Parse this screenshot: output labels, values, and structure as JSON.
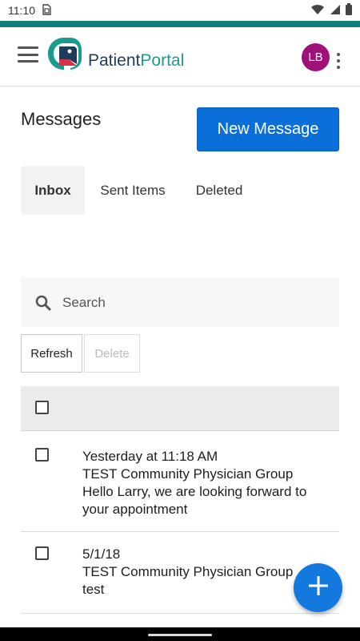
{
  "status_bar": {
    "time": "11:10",
    "icons": [
      "sim-icon",
      "wifi-icon",
      "signal-icon",
      "battery-icon"
    ]
  },
  "header": {
    "brand_part1": "Patient",
    "brand_part2": "Portal",
    "avatar_initials": "LB",
    "colors": {
      "accent": "#0f7f7f",
      "avatar": "#a0107a",
      "brand_dark": "#1f3b5a",
      "brand_teal": "#1c9a90"
    }
  },
  "main": {
    "title": "Messages",
    "new_message_label": "New Message",
    "tabs": [
      {
        "label": "Inbox",
        "active": true
      },
      {
        "label": "Sent Items",
        "active": false
      },
      {
        "label": "Deleted",
        "active": false
      }
    ],
    "search": {
      "placeholder": "Search",
      "value": ""
    },
    "actions": {
      "refresh_label": "Refresh",
      "delete_label": "Delete"
    }
  },
  "messages": [
    {
      "date": "Yesterday at 11:18 AM",
      "sender": "TEST Community Physician Group",
      "preview": "Hello Larry, we are looking forward to your appointment"
    },
    {
      "date": "5/1/18",
      "sender": "TEST Community Physician Group",
      "preview": "test"
    }
  ],
  "fab": {
    "icon": "plus-icon",
    "color": "#1479df"
  },
  "primary_color": "#0a6fd8"
}
